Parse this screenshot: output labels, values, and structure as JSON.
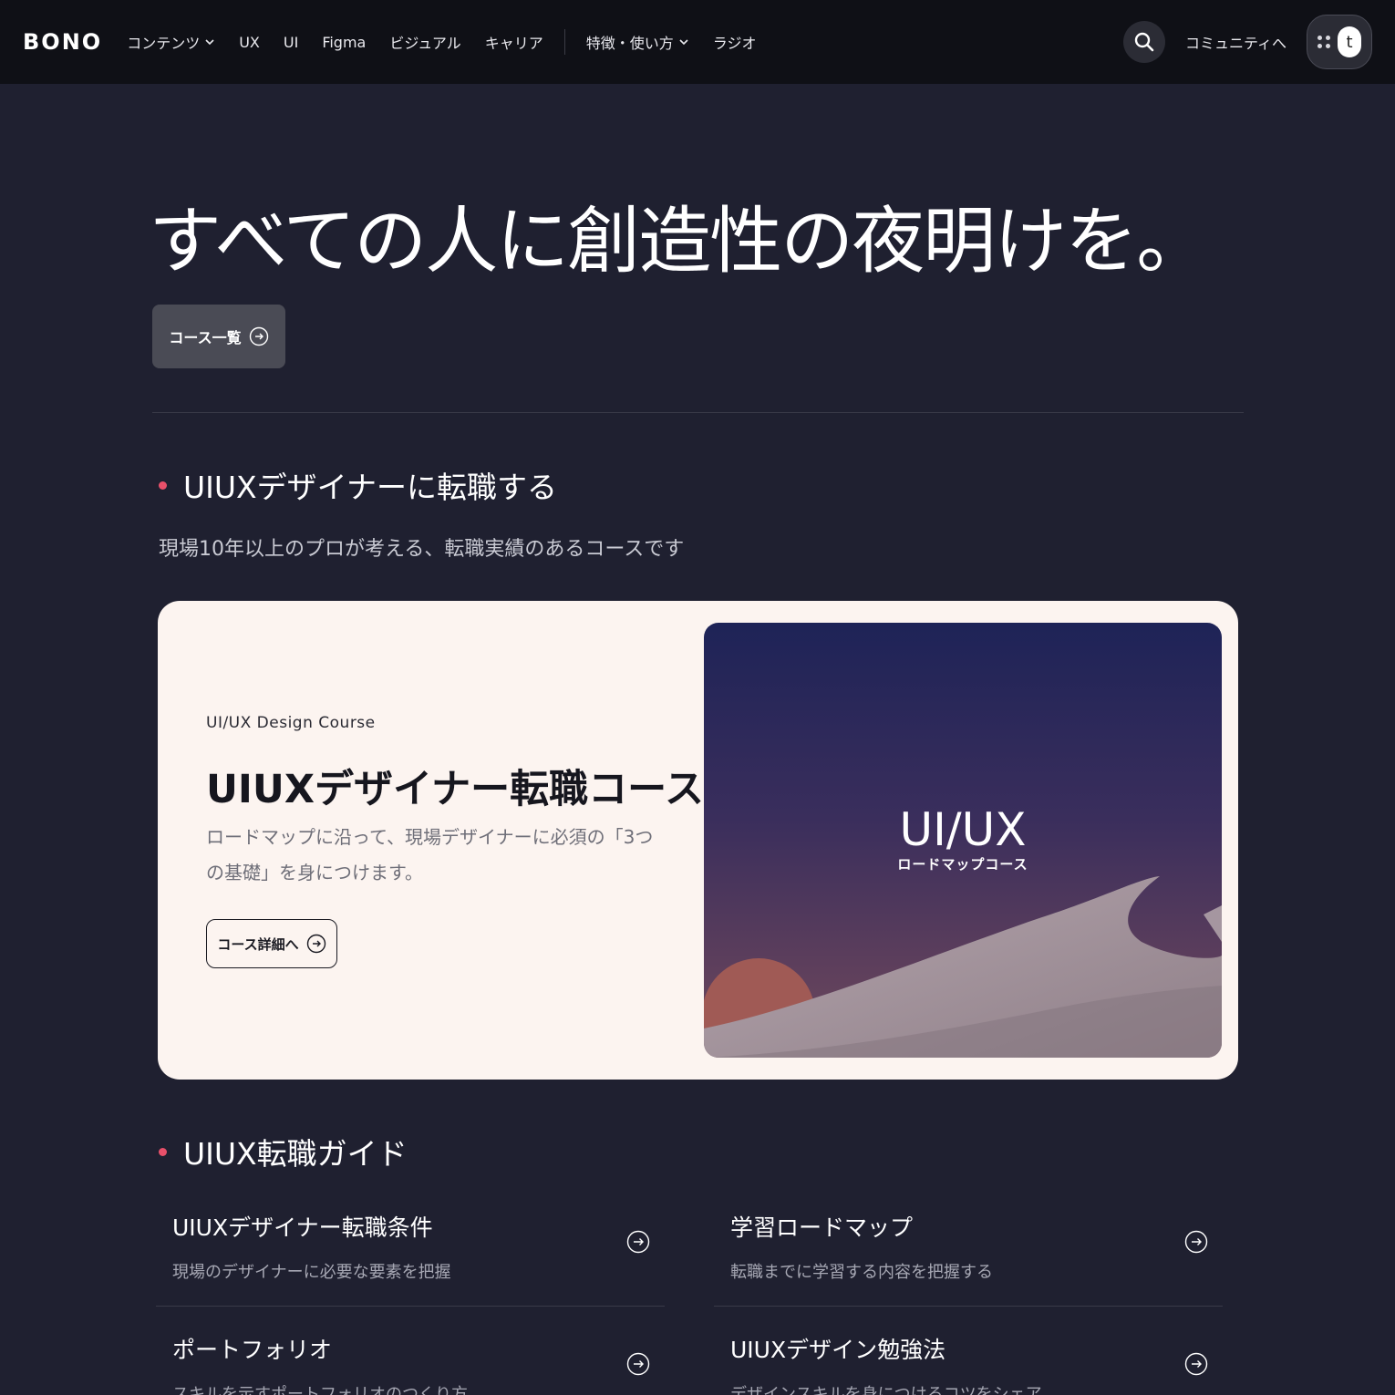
{
  "nav": {
    "logo": "BONO",
    "items": [
      {
        "label": "コンテンツ",
        "dropdown": true
      },
      {
        "label": "UX",
        "dropdown": false
      },
      {
        "label": "UI",
        "dropdown": false
      },
      {
        "label": "Figma",
        "dropdown": false
      },
      {
        "label": "ビジュアル",
        "dropdown": false
      },
      {
        "label": "キャリア",
        "dropdown": false
      }
    ],
    "items_after_divider": [
      {
        "label": "特徴・使い方",
        "dropdown": true
      },
      {
        "label": "ラジオ",
        "dropdown": false
      }
    ],
    "community_label": "コミュニティへ",
    "avatar_letter": "t"
  },
  "hero": {
    "title": "すべての人に創造性の夜明けを。",
    "course_list_label": "コース一覧"
  },
  "section_career": {
    "heading": "UIUXデザイナーに転職する",
    "subtitle": "現場10年以上のプロが考える、転職実績のあるコースです",
    "card": {
      "eyebrow": "UI/UX Design Course",
      "title": "UIUXデザイナー転職コース",
      "description": "ロードマップに沿って、現場デザイナーに必須の「3つの基礎」を身につけます。",
      "button_label": "コース詳細へ",
      "image_title": "UI/UX",
      "image_subtitle": "ロードマップコース"
    }
  },
  "section_guide": {
    "heading": "UIUX転職ガイド",
    "items": [
      {
        "title": "UIUXデザイナー転職条件",
        "subtitle": "現場のデザイナーに必要な要素を把握"
      },
      {
        "title": "学習ロードマップ",
        "subtitle": "転職までに学習する内容を把握する"
      },
      {
        "title": "ポートフォリオ",
        "subtitle": "スキルを示すポートフォリオのつくり方"
      },
      {
        "title": "UIUXデザイン勉強法",
        "subtitle": "デザインスキルを身につけるコツをシェア"
      }
    ]
  },
  "colors": {
    "nav_bg": "#0f1016",
    "page_bg": "#1f2030",
    "accent_bullet": "#e8506a",
    "card_bg": "#fcf4f0"
  },
  "icons": [
    "search-icon",
    "chevron-down-icon",
    "circle-arrow-right-icon",
    "apps-dots-icon"
  ]
}
